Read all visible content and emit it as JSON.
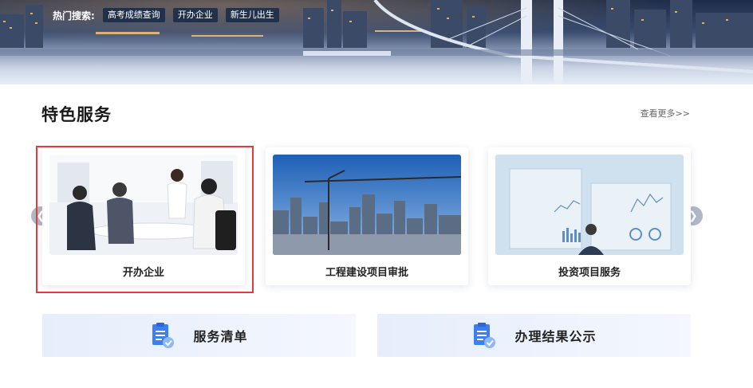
{
  "hot_search": {
    "label": "热门搜索:",
    "tags": [
      "高考成绩查询",
      "开办企业",
      "新生儿出生"
    ]
  },
  "featured": {
    "title": "特色服务",
    "more": "查看更多>>",
    "cards": [
      {
        "label": "开办企业",
        "image": "business-meeting-photo",
        "selected": true
      },
      {
        "label": "工程建设项目审批",
        "image": "city-construction-crane-photo",
        "selected": false
      },
      {
        "label": "投资项目服务",
        "image": "financial-report-photo",
        "selected": false
      }
    ],
    "prev_icon": "chevron-left-icon",
    "next_icon": "chevron-right-icon"
  },
  "bottom_links": [
    {
      "label": "服务清单",
      "icon": "clipboard-check-icon"
    },
    {
      "label": "办理结果公示",
      "icon": "clipboard-check-icon"
    }
  ],
  "colors": {
    "selection_border": "#e03c3c",
    "icon_blue": "#3d7ff2",
    "button_bg": "#e6eefc"
  }
}
